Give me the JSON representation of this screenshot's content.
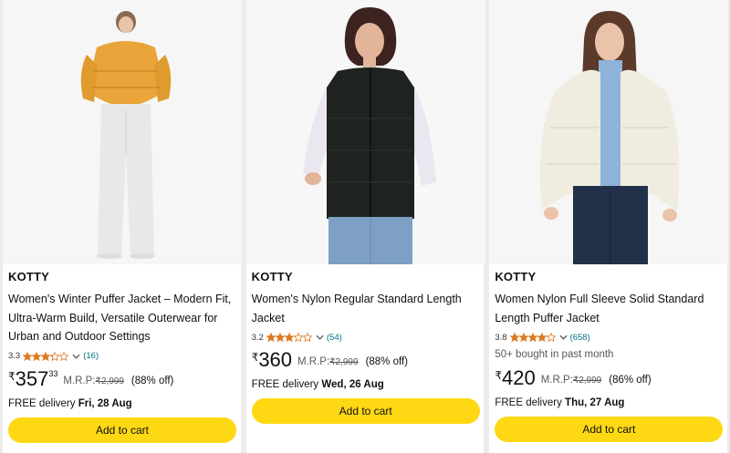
{
  "products": [
    {
      "brand": "KOTTY",
      "title_line1": "Women's Winter Puffer Jacket – Modern Fit,",
      "title_line2": "Ultra-Warm Build, Versatile Outerwear for",
      "title_line3": "Urban and Outdoor Settings",
      "rating": "3.3",
      "stars_filled": 3.3,
      "rating_count": "(16)",
      "bought": "",
      "currency": "₹",
      "price_whole": "357",
      "price_fraction": "33",
      "mrp_label": "M.R.P:",
      "mrp_value": "₹2,999",
      "discount": "(88% off)",
      "delivery_prefix": "FREE delivery",
      "delivery_date": "Fri, 28 Aug",
      "cart_label": "Add to cart",
      "image_colors": {
        "jacket": "#e9a53a",
        "lower": "#e8e8e8",
        "bg": "#f6f6f6"
      }
    },
    {
      "brand": "KOTTY",
      "title_line1": "Women's Nylon Regular Standard Length",
      "title_line2": "Jacket",
      "title_line3": "",
      "rating": "3.2",
      "stars_filled": 3.2,
      "rating_count": "(54)",
      "bought": "",
      "currency": "₹",
      "price_whole": "360",
      "price_fraction": "",
      "mrp_label": "M.R.P:",
      "mrp_value": "₹2,999",
      "discount": "(88% off)",
      "delivery_prefix": "FREE delivery",
      "delivery_date": "Wed, 26 Aug",
      "cart_label": "Add to cart",
      "image_colors": {
        "jacket": "#1e2320",
        "lower": "#7da0c4",
        "bg": "#f7f7f7"
      }
    },
    {
      "brand": "KOTTY",
      "title_line1": "Women Nylon Full Sleeve Solid Standard",
      "title_line2": "Length Puffer Jacket",
      "title_line3": "",
      "rating": "3.8",
      "stars_filled": 3.8,
      "rating_count": "(658)",
      "bought": "50+ bought in past month",
      "currency": "₹",
      "price_whole": "420",
      "price_fraction": "",
      "mrp_label": "M.R.P:",
      "mrp_value": "₹2,999",
      "discount": "(86% off)",
      "delivery_prefix": "FREE delivery",
      "delivery_date": "Thu, 27 Aug",
      "cart_label": "Add to cart",
      "image_colors": {
        "jacket": "#f0ece0",
        "lower": "#23304a",
        "bg": "#f6f6f6"
      }
    }
  ],
  "colors": {
    "star": "#de7921",
    "link": "#007185",
    "cart_button": "#ffd814"
  }
}
